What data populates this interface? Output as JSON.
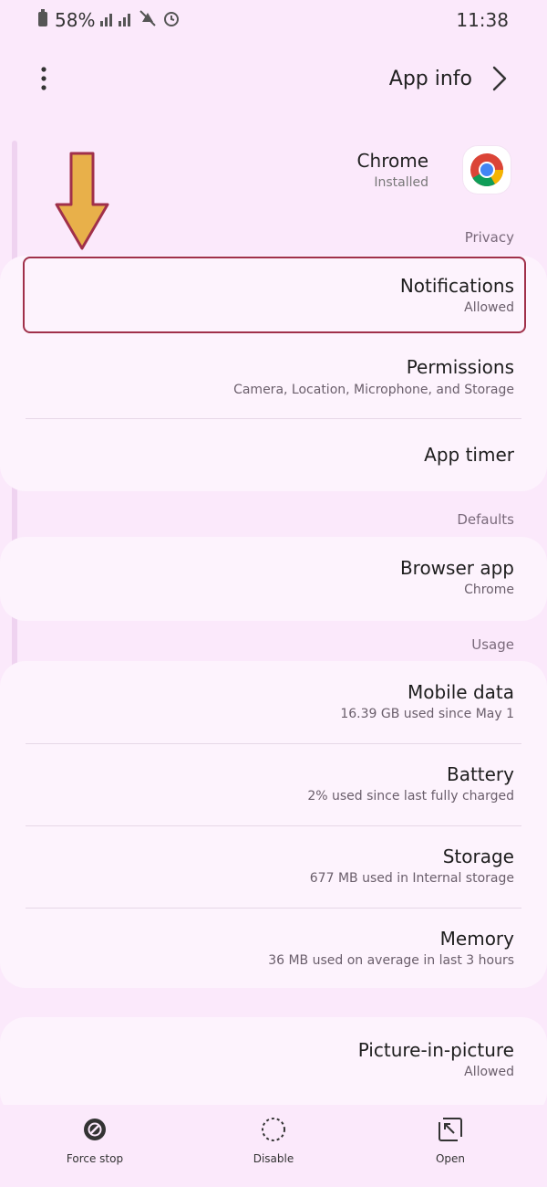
{
  "statusbar": {
    "time": "11:38",
    "battery_percent": "58%"
  },
  "header": {
    "title": "App info"
  },
  "app": {
    "name": "Chrome",
    "status": "Installed"
  },
  "sections": {
    "privacy": "Privacy",
    "defaults": "Defaults",
    "usage": "Usage"
  },
  "items": {
    "notifications": {
      "title": "Notifications",
      "sub": "Allowed"
    },
    "permissions": {
      "title": "Permissions",
      "sub": "Camera, Location, Microphone, and Storage"
    },
    "app_timer": {
      "title": "App timer"
    },
    "browser_app": {
      "title": "Browser app",
      "sub": "Chrome"
    },
    "mobile_data": {
      "title": "Mobile data",
      "sub": "16.39 GB used since May 1"
    },
    "battery": {
      "title": "Battery",
      "sub": "2% used since last fully charged"
    },
    "storage": {
      "title": "Storage",
      "sub": "677 MB used in Internal storage"
    },
    "memory": {
      "title": "Memory",
      "sub": "36 MB used on average in last 3 hours"
    },
    "pip": {
      "title": "Picture-in-picture",
      "sub": "Allowed"
    }
  },
  "bottom": {
    "open": "Open",
    "disable": "Disable",
    "force_stop": "Force stop"
  },
  "colors": {
    "background": "#fbe9fb",
    "card": "#fdf3fd",
    "highlight_border": "#a0304a",
    "arrow_fill": "#e8b04a"
  },
  "icons": [
    "battery-icon",
    "signal-icon",
    "mute-icon",
    "alarm-icon",
    "more-options-icon",
    "back-chevron-icon",
    "chrome-icon",
    "open-icon",
    "disable-icon",
    "force-stop-icon",
    "down-arrow-icon"
  ]
}
